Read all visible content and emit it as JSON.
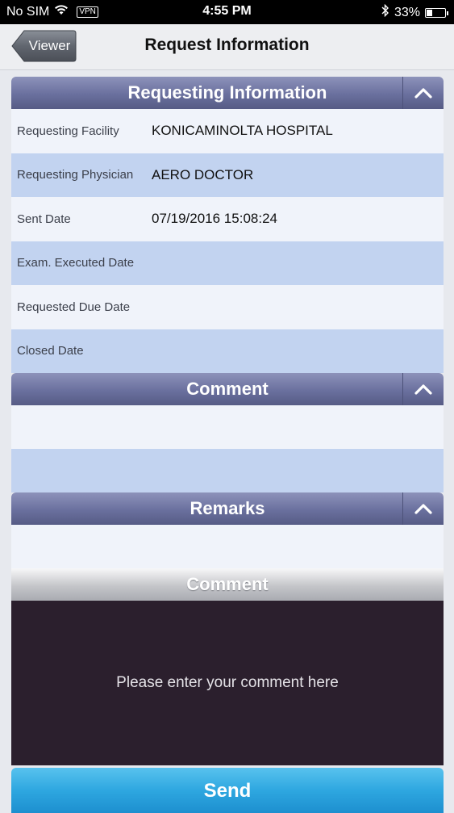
{
  "status_bar": {
    "carrier": "No SIM",
    "vpn": "VPN",
    "time": "4:55 PM",
    "battery": "33%",
    "battery_level": 0.33
  },
  "nav": {
    "back_label": "Viewer",
    "title": "Request Information"
  },
  "sections": {
    "requesting": {
      "title": "Requesting Information",
      "rows": [
        {
          "label": "Requesting Facility",
          "value": "KONICAMINOLTA HOSPITAL"
        },
        {
          "label": "Requesting Physician",
          "value": "AERO DOCTOR"
        },
        {
          "label": "Sent Date",
          "value": "07/19/2016 15:08:24"
        },
        {
          "label": "Exam. Executed Date",
          "value": ""
        },
        {
          "label": "Requested Due Date",
          "value": ""
        },
        {
          "label": "Closed Date",
          "value": ""
        }
      ]
    },
    "comment": {
      "title": "Comment"
    },
    "remarks": {
      "title": "Remarks"
    }
  },
  "comment_input": {
    "title": "Comment",
    "placeholder": "Please enter your comment here"
  },
  "send_label": "Send",
  "icons": {
    "wifi": "wifi-icon",
    "bluetooth": "bluetooth-icon",
    "battery": "battery-icon",
    "collapse": "chevron-up-icon"
  }
}
